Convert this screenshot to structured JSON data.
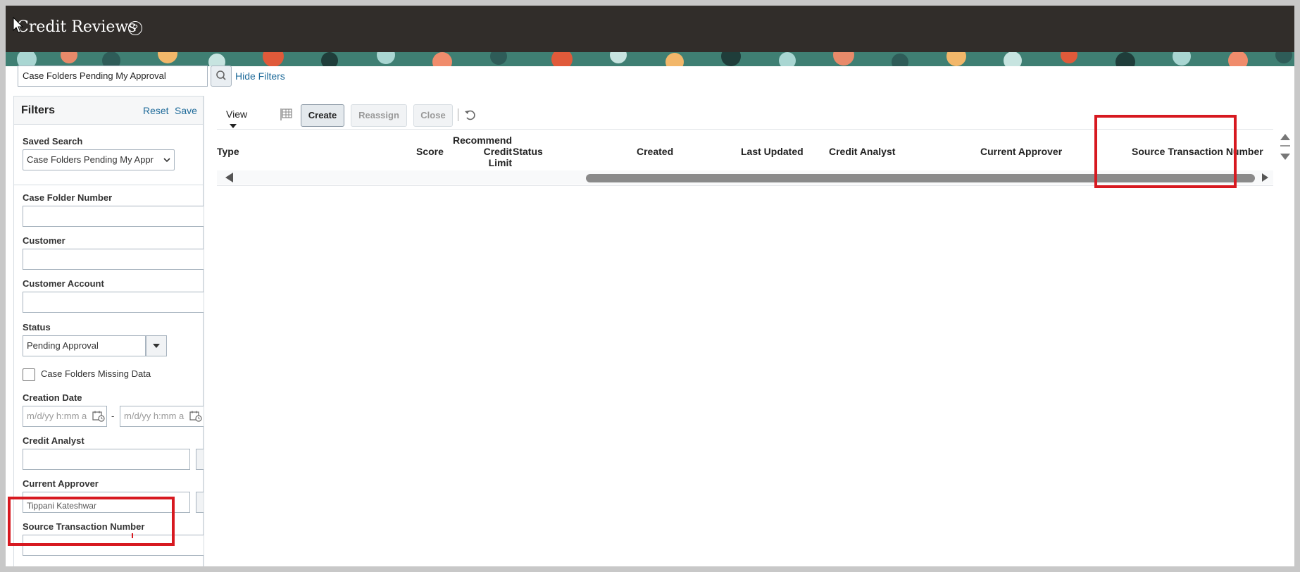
{
  "header": {
    "title": "Credit Reviews",
    "help_icon": "?"
  },
  "search": {
    "value": "Case Folders Pending My Approval",
    "hide_filters_label": "Hide Filters"
  },
  "filters": {
    "title": "Filters",
    "reset_label": "Reset",
    "save_label": "Save",
    "saved_search_label": "Saved Search",
    "saved_search_value": "Case Folders Pending My Appr",
    "case_folder_number_label": "Case Folder Number",
    "customer_label": "Customer",
    "customer_account_label": "Customer Account",
    "status_label": "Status",
    "status_value": "Pending Approval",
    "missing_data_label": "Case Folders Missing Data",
    "creation_date_label": "Creation Date",
    "date_placeholder": "m/d/yy h:mm a",
    "date_separator": "-",
    "credit_analyst_label": "Credit Analyst",
    "current_approver_label": "Current Approver",
    "current_approver_value": "Tippani Kateshwar",
    "source_transaction_number_label": "Source Transaction Number"
  },
  "toolbar": {
    "view_label": "View",
    "create_label": "Create",
    "reassign_label": "Reassign",
    "close_label": "Close"
  },
  "table": {
    "columns": {
      "type": "Type",
      "score": "Score",
      "recommended_l1": "Recommend",
      "recommended_l2": "Credit",
      "recommended_l3": "Limit",
      "status": "Status",
      "created": "Created",
      "last_updated": "Last Updated",
      "credit_analyst": "Credit Analyst",
      "current_approver": "Current Approver",
      "source_transaction_number": "Source Transaction Number"
    }
  },
  "colors": {
    "header_bg": "#312d2a",
    "link": "#1f6b9a",
    "highlight": "#d71920"
  }
}
